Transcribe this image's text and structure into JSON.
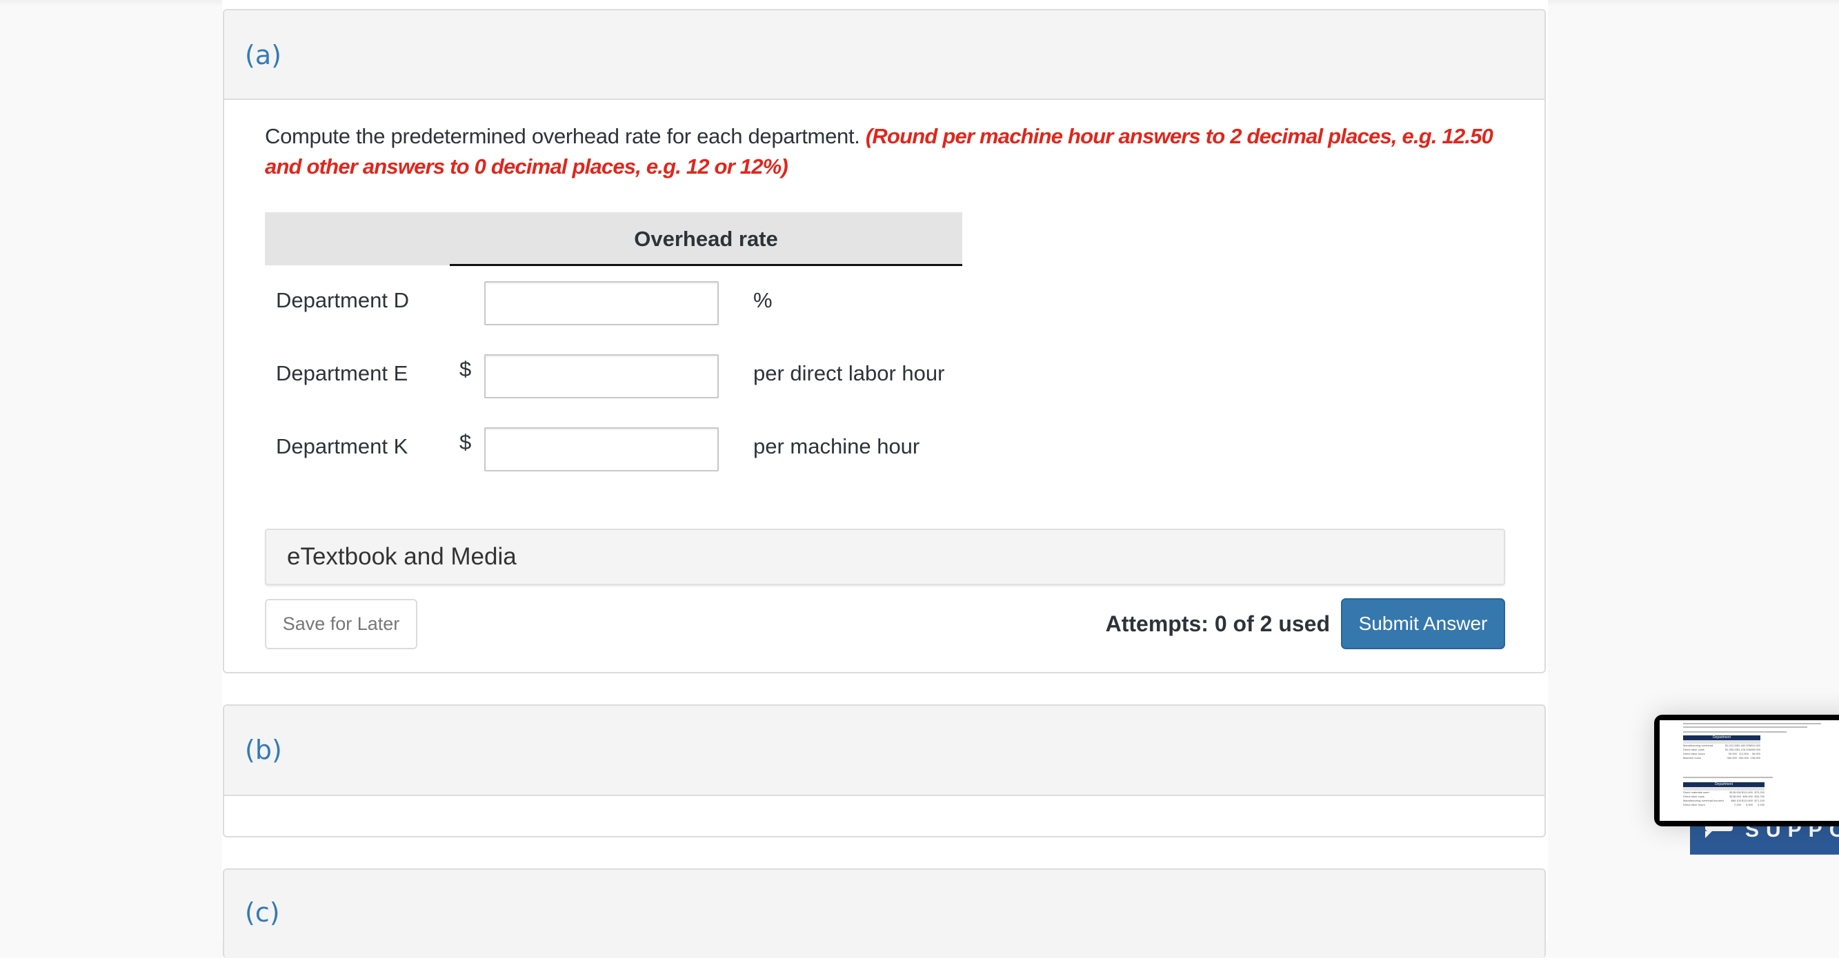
{
  "parts": [
    {
      "label": "(a)"
    },
    {
      "label": "(b)"
    },
    {
      "label": "(c)"
    }
  ],
  "question": {
    "instruction": "Compute the predetermined overhead rate for each department. ",
    "hint": "(Round per machine hour answers to 2 decimal places, e.g. 12.50 and other answers to 0 decimal places, e.g. 12 or 12%)"
  },
  "table": {
    "column_header": "Overhead rate",
    "rows": [
      {
        "label": "Department D",
        "prefix": "",
        "value": "",
        "unit": "%"
      },
      {
        "label": "Department E",
        "prefix": "$",
        "value": "",
        "unit": "per direct labor hour"
      },
      {
        "label": "Department K",
        "prefix": "$",
        "value": "",
        "unit": "per machine hour"
      }
    ]
  },
  "etextbook": {
    "label": "eTextbook and Media"
  },
  "actions": {
    "save_label": "Save for Later",
    "attempts_text": "Attempts: 0 of 2 used",
    "submit_label": "Submit Answer"
  },
  "support": {
    "label": "SUPPORT"
  },
  "thumbnail": {
    "table1": {
      "header": "Department",
      "cols": [
        "D",
        "E",
        "K"
      ],
      "rows": [
        {
          "label": "Manufacturing overhead",
          "values": [
            "$1,012,500",
            "$1,462,500",
            "$810,000"
          ]
        },
        {
          "label": "Direct labor costs",
          "values": [
            "$1,350,000",
            "$1,125,000",
            "$405,000"
          ]
        },
        {
          "label": "Direct labor hours",
          "values": [
            "90,000",
            "112,500",
            "36,000"
          ]
        },
        {
          "label": "Machine hours",
          "values": [
            "360,000",
            "450,000",
            "108,000"
          ]
        }
      ]
    },
    "table2": {
      "header": "Department",
      "cols": [
        "D",
        "E",
        "K"
      ],
      "rows": [
        {
          "label": "Direct materials used",
          "values": [
            "$126,000",
            "$111,400",
            "$70,200"
          ]
        },
        {
          "label": "Direct labor costs",
          "values": [
            "$108,000",
            "$99,000",
            "$33,750"
          ]
        },
        {
          "label": "Manufacturing overhead incurred",
          "values": [
            "$89,100",
            "$111,600",
            "$71,100"
          ]
        },
        {
          "label": "Direct labor hours",
          "values": [
            "7,200",
            "9,900",
            "3,150"
          ]
        }
      ]
    }
  },
  "colors": {
    "accent": "#337ab7",
    "hint_red": "#e0261c",
    "submit_bg": "#3578ad",
    "support_bg": "#2d5a96"
  }
}
